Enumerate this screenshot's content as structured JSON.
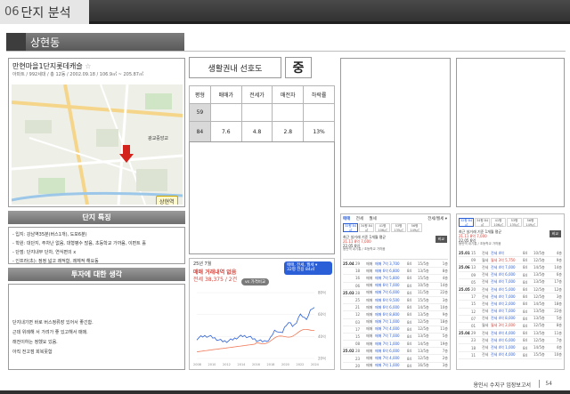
{
  "header": {
    "number": "06",
    "title": "단지 분석"
  },
  "section": {
    "title": "상현동"
  },
  "complex": {
    "name": "만현마을1단지롯데캐슬",
    "star": "☆",
    "meta": "아파트 / 992세대 / 총 12동 / 2002.09.18 / 106.9㎡ ~ 205.87㎡",
    "map_label": "상현역",
    "map_label2": "광교중앙교"
  },
  "preference": {
    "label": "생활권내 선호도",
    "value": "중"
  },
  "price_table": {
    "headers": [
      "평형",
      "매매가",
      "전세가",
      "매전차",
      "하락률"
    ],
    "rows": [
      [
        "59",
        "",
        "",
        "",
        ""
      ],
      [
        "84",
        "7.6",
        "4.8",
        "2.8",
        "13%"
      ]
    ]
  },
  "features": {
    "title": "단지 특징",
    "items": [
      "- 입지: 강남역35분(버스1개), 도보6분)",
      "- 학원: 대단지, 주차난 없음, 대형평수 많음, 초등학교 가까움, 이편트 홀",
      "- 단점: 단지내부 단차, 연식편의 x",
      "- 인프라(초): 정정 넓고 쾌적함, 쾌체적 해요동"
    ]
  },
  "opinion": {
    "title": "투자에 대한 생각",
    "items": [
      "단지내기면 바로 버스정류장 있어서 좋긴함.",
      "근데 위례해 서 가려가 좋 있고해서 매매.",
      "래전이하는 정했요 있음.",
      "아직 전고점 회복못함"
    ]
  },
  "chart": {
    "tag": "25년 7월",
    "title": "매매 거래내역 없음",
    "subtitle": "전세 38,375 / 2건",
    "legend_line1": "매매, 전세, 월세 ▾",
    "legend_line2": "32평  전용 84㎡",
    "vs_label": "vs  가격비교",
    "y_ticks": [
      "80억",
      "60억",
      "40억",
      "20억"
    ],
    "x_ticks": [
      "2008",
      "2010",
      "2012",
      "2014",
      "2016",
      "2018",
      "2020",
      "2022",
      "2024"
    ]
  },
  "listing1": {
    "tabs": [
      "매매",
      "전세",
      "월세"
    ],
    "active_tab": "매매",
    "right_label": "전세/월세 ▾",
    "types": [
      "32평\n84㎡",
      "34평\n84㎡",
      "41평\n106㎡",
      "53평\n135㎡",
      "56평\n149㎡"
    ],
    "summary_line1": "최근 실거래 기준 1개월 평균",
    "summary_price": "21.11  8억 7,000",
    "summary_line2": "22.05  6억",
    "button": "비교",
    "tags": "동탄역 내기통  /  초등학교 가까움",
    "columns": [
      "계약일",
      "",
      "가격",
      "타입",
      "거래",
      "층"
    ],
    "rows": [
      [
        "25.04",
        "29",
        "매매",
        "매매 7억 3,700",
        "84",
        "15/5층",
        "1층"
      ],
      [
        "",
        "18",
        "매매",
        "매매 6억 6,800",
        "84",
        "13/5층",
        "8층"
      ],
      [
        "",
        "16",
        "매매",
        "매매 7억 5,800",
        "84",
        "15/5층",
        "4층"
      ],
      [
        "",
        "06",
        "매매",
        "매매 6억 7,000",
        "84",
        "10/5층",
        "14층"
      ],
      [
        "25.03",
        "28",
        "매매",
        "매매 7억 6,000",
        "84",
        "11/5층",
        "22층"
      ],
      [
        "",
        "25",
        "매매",
        "매매 6억 9,500",
        "84",
        "15/5층",
        "3층"
      ],
      [
        "",
        "21",
        "매매",
        "매매 6억 6,000",
        "84",
        "14/5층",
        "10층"
      ],
      [
        "",
        "12",
        "매매",
        "매매 6억 8,800",
        "84",
        "13/5층",
        "9층"
      ],
      [
        "",
        "03",
        "매매",
        "매매 7억 1,000",
        "84",
        "12/5층",
        "18층"
      ],
      [
        "",
        "17",
        "매매",
        "매매 7억 4,000",
        "84",
        "12/5층",
        "11층"
      ],
      [
        "",
        "15",
        "매매",
        "매매 7억 7,000",
        "84",
        "13/5층",
        "5층"
      ],
      [
        "",
        "08",
        "매매",
        "매매 7억 1,000",
        "84",
        "14/5층",
        "19층"
      ],
      [
        "25.02",
        "28",
        "매매",
        "매매 6억 6,000",
        "84",
        "13/5층",
        "7층"
      ],
      [
        "",
        "23",
        "매매",
        "매매 7억 4,000",
        "84",
        "12/5층",
        "2층"
      ],
      [
        "",
        "20",
        "매매",
        "매매 7억 1,000",
        "84",
        "16/5층",
        "3층"
      ]
    ]
  },
  "listing2": {
    "types": [
      "32평\n84㎡",
      "34평\n84㎡",
      "41평\n106㎡",
      "53평\n135㎡",
      "56평\n149㎡"
    ],
    "summary_line1": "최근 실거래 기준 1개월 평균",
    "summary_price": "21.11  8억 7,000",
    "summary_line2": "22.05  6억",
    "button": "비교",
    "tags": "동탄역 내기통  /  초등학교 가까움",
    "rows": [
      [
        "25.01",
        "15",
        "전세",
        "전세 4억",
        "84",
        "10/5층",
        "4층"
      ],
      [
        "",
        "09",
        "월세",
        "월세 3억 5,750",
        "84",
        "12/5층",
        "9층"
      ],
      [
        "25.06",
        "13",
        "전세",
        "전세 4억 7,000",
        "84",
        "14/5층",
        "14층"
      ],
      [
        "",
        "09",
        "전세",
        "전세 4억 6,000",
        "84",
        "13/5층",
        "6층"
      ],
      [
        "",
        "05",
        "전세",
        "전세 4억 7,000",
        "84",
        "13/5층",
        "17층"
      ],
      [
        "25.05",
        "20",
        "전세",
        "전세 4억 5,000",
        "84",
        "12/5층",
        "12층"
      ],
      [
        "",
        "17",
        "전세",
        "전세 4억 7,000",
        "84",
        "12/5층",
        "3층"
      ],
      [
        "",
        "15",
        "전세",
        "전세 4억 2,000",
        "84",
        "14/5층",
        "18층"
      ],
      [
        "",
        "12",
        "전세",
        "전세 4억 7,000",
        "84",
        "13/5층",
        "22층"
      ],
      [
        "",
        "07",
        "전세",
        "전세 4억 8,000",
        "84",
        "13/5층",
        "5층"
      ],
      [
        "",
        "01",
        "월세",
        "월세 3억 2,000",
        "84",
        "12/5층",
        "8층"
      ],
      [
        "25.04",
        "29",
        "전세",
        "전세 4억 4,000",
        "84",
        "13/5층",
        "11층"
      ],
      [
        "",
        "23",
        "전세",
        "전세 4억 6,000",
        "84",
        "12/5층",
        "7층"
      ],
      [
        "",
        "18",
        "전세",
        "전세 4억 1,000",
        "84",
        "14/5층",
        "4층"
      ],
      [
        "",
        "11",
        "전세",
        "전세 4억 4,000",
        "84",
        "15/5층",
        "10층"
      ]
    ]
  },
  "footer": {
    "text": "용인시 수지구 임장보고서",
    "page": "54"
  }
}
